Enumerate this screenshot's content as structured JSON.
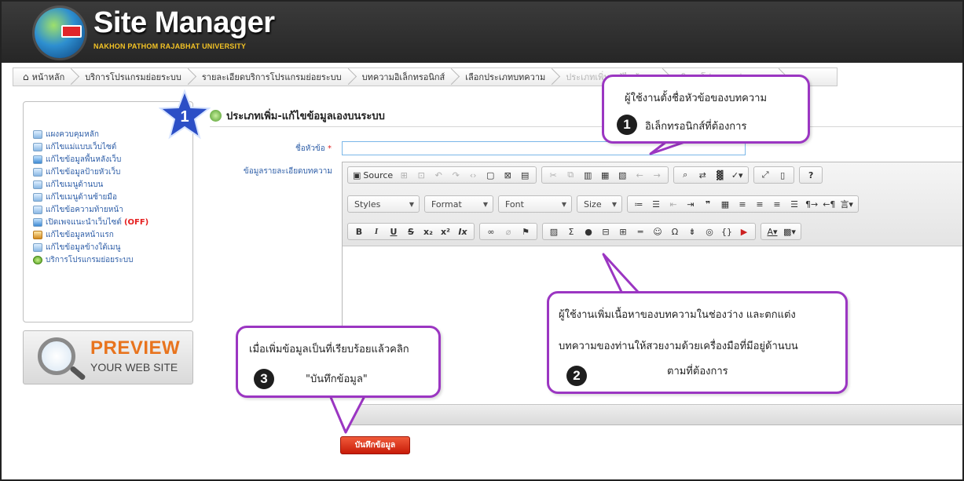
{
  "header": {
    "app_title": "Site Manager",
    "app_subtitle": "NAKHON PATHOM RAJABHAT UNIVERSITY"
  },
  "breadcrumb": {
    "items": [
      "หน้าหลัก",
      "บริการโปรแกรมย่อยระบบ",
      "รายละเอียดบริการโปรแกรมย่อยระบบ",
      "บทความอิเล็กทรอนิกส์",
      "เลือกประเภทบทความ",
      "ประเภทเพิ่ม-แก้ไขข้อมูล",
      "บริการโปรแกรมย่อยระบบ"
    ]
  },
  "sidebar": {
    "items": [
      {
        "label": "แผงควบคุมหลัก",
        "icon": "dashboard-icon"
      },
      {
        "label": "แก้ไขแม่แบบเว็บไซต์",
        "icon": "template-icon"
      },
      {
        "label": "แก้ไขข้อมูลพื้นหลังเว็บ",
        "icon": "background-icon"
      },
      {
        "label": "แก้ไขข้อมูลป้ายหัวเว็บ",
        "icon": "banner-icon"
      },
      {
        "label": "แก้ไขเมนูด้านบน",
        "icon": "top-menu-icon"
      },
      {
        "label": "แก้ไขเมนูด้านซ้ายมือ",
        "icon": "left-menu-icon"
      },
      {
        "label": "แก้ไขข้อความท้ายหน้า",
        "icon": "footer-icon"
      },
      {
        "label": "เปิดเพจแนะนำเว็บไซต์",
        "icon": "intro-page-icon",
        "badge": "(OFF)"
      },
      {
        "label": "แก้ไขข้อมูลหน้าแรก",
        "icon": "home-icon"
      },
      {
        "label": "แก้ไขข้อมูลข้างใต้เมนู",
        "icon": "under-menu-icon"
      },
      {
        "label": "บริการโปรแกรมย่อยระบบ",
        "icon": "subprogram-icon"
      }
    ],
    "preview_title": "PREVIEW",
    "preview_subtitle": "YOUR WEB SITE"
  },
  "main": {
    "heading": "ประเภทเพิ่ม-แก้ไขข้อมูลเองบนระบบ",
    "field_title_label": "ชื่อหัวข้อ",
    "field_title_required": "*",
    "field_title_value": "",
    "field_detail_label": "ข้อมูลรายละเอียดบทความ",
    "save_button_label": "บันทึกข้อมูล"
  },
  "editor": {
    "source_label": "Source",
    "styles_label": "Styles",
    "format_label": "Format",
    "font_label": "Font",
    "size_label": "Size",
    "row3_text": [
      "B",
      "I",
      "U",
      "S",
      "x₂",
      "x²",
      "Ix"
    ],
    "icon_names": [
      "source-icon",
      "save-icon",
      "templates-icon",
      "undo-icon",
      "redo-icon",
      "cut-icon",
      "copy-icon",
      "paste-icon",
      "paste-text-icon",
      "paste-word-icon",
      "find-icon",
      "replace-icon",
      "select-all-icon",
      "spellcheck-icon",
      "maximize-icon",
      "show-blocks-icon",
      "help-icon",
      "bold-icon",
      "italic-icon",
      "underline-icon",
      "strike-icon",
      "subscript-icon",
      "superscript-icon",
      "remove-format-icon",
      "link-icon",
      "unlink-icon",
      "anchor-icon",
      "image-icon",
      "math-icon",
      "flash-icon",
      "iframe-icon",
      "table-icon",
      "hline-icon",
      "smiley-icon",
      "special-char-icon",
      "pagebreak-icon",
      "google-icon",
      "code-snippet-icon",
      "youtube-icon",
      "text-color-icon",
      "bg-color-icon"
    ]
  },
  "callouts": {
    "c1_line1": "ผู้ใช้งานตั้งชื่อหัวข้อของบทความ",
    "c1_line2": "อิเล็กทรอนิกส์ที่ต้องการ",
    "c1_num": "1",
    "c2_line1": "ผู้ใช้งานเพิ่มเนื้อหาของบทความในช่องว่าง และตกแต่ง",
    "c2_line2": "บทความของท่านให้สวยงามด้วยเครื่องมือที่มีอยู่ด้านบน",
    "c2_line3": "ตามที่ต้องการ",
    "c2_num": "2",
    "c3_line1": "เมื่อเพิ่มข้อมูลเป็นที่เรียบร้อยแล้วคลิก",
    "c3_line2": "\"บันทึกข้อมูล\"",
    "c3_num": "3",
    "star_num": "1"
  },
  "colors": {
    "callout_border": "#9b36c2",
    "save_button": "#d7260f",
    "star_fill": "#2c4fc6"
  }
}
